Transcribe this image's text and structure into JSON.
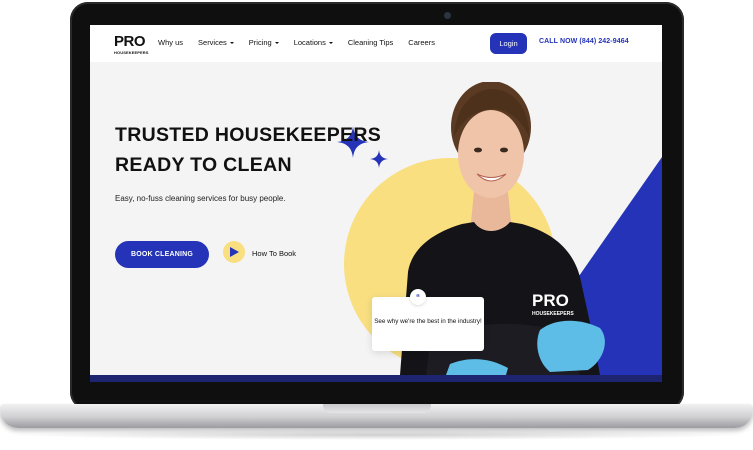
{
  "logo": {
    "main": "PRO",
    "sub": "HOUSEKEEPERS"
  },
  "nav": {
    "items": [
      {
        "label": "Why us",
        "dropdown": false
      },
      {
        "label": "Services",
        "dropdown": true
      },
      {
        "label": "Pricing",
        "dropdown": true
      },
      {
        "label": "Locations",
        "dropdown": true
      },
      {
        "label": "Cleaning Tips",
        "dropdown": false
      },
      {
        "label": "Careers",
        "dropdown": false
      }
    ],
    "login_label": "Login",
    "call_label": "CALL NOW (844) 242-9464"
  },
  "hero": {
    "title_line1": "TRUSTED HOUSEKEEPERS",
    "title_line2": "READY TO CLEAN",
    "subtitle": "Easy, no-fuss cleaning services for busy people.",
    "book_button": "BOOK CLEANING",
    "how_to_label": "How To Book",
    "shirt_logo": "PRO",
    "shirt_logo_sub": "HOUSEKEEPERS"
  },
  "quote": {
    "mark": "“",
    "text": "See why we're the best in the industry!"
  },
  "colors": {
    "brand_blue": "#2433b7",
    "brand_yellow": "#f9df80",
    "dark_navy": "#1d2570",
    "background": "#f4f4f4"
  },
  "icons": [
    "play-icon",
    "sparkle-star-icon",
    "quote-icon",
    "caret-down-icon"
  ]
}
